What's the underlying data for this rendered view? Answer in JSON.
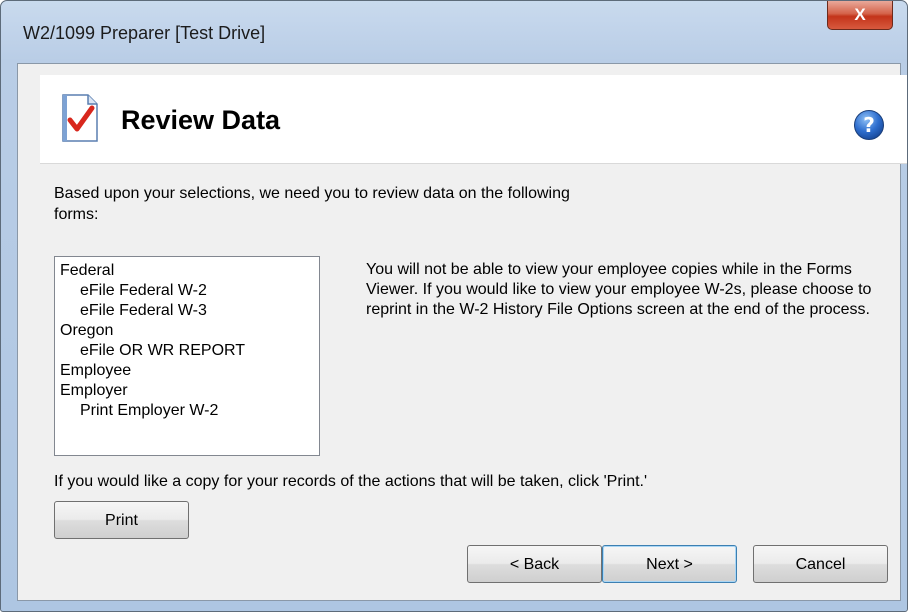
{
  "window": {
    "title": "W2/1099 Preparer [Test Drive]",
    "close_label": "X"
  },
  "header": {
    "title": "Review Data",
    "icon": "checklist-document-icon",
    "help_icon": "help-question-icon"
  },
  "intro_text": "Based upon your selections, we need you to review data on the following forms:",
  "forms_list": {
    "items": [
      {
        "label": "Federal",
        "level": 0
      },
      {
        "label": "eFile Federal W-2",
        "level": 1
      },
      {
        "label": "eFile Federal W-3",
        "level": 1
      },
      {
        "label": "Oregon",
        "level": 0
      },
      {
        "label": "eFile OR WR REPORT",
        "level": 1
      },
      {
        "label": "Employee",
        "level": 0
      },
      {
        "label": "Employer",
        "level": 0
      },
      {
        "label": "Print Employer W-2",
        "level": 1
      }
    ]
  },
  "note_text": "You will not be able to view your employee copies while in the Forms Viewer. If you would like to view your employee W-2s, please choose to reprint in the W-2 History File Options screen at the end of the process.",
  "records_text": "If you would like a copy for your records of the actions that will be taken, click 'Print.'",
  "buttons": {
    "print": "Print",
    "back": "< Back",
    "next": "Next >",
    "cancel": "Cancel"
  },
  "colors": {
    "title_bar": "#b9cde6",
    "close_button": "#c3341a",
    "dialog_background": "#f0f0f0",
    "default_button_border": "#3c7fb1"
  }
}
